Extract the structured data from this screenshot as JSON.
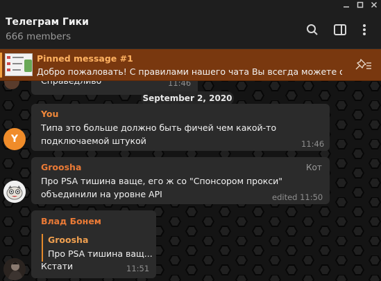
{
  "window": {
    "minimize_icon": "minimize-icon",
    "maximize_icon": "maximize-icon",
    "close_icon": "close-icon"
  },
  "header": {
    "title": "Телеграм Гики",
    "members": "666 members",
    "icons": [
      "search-icon",
      "sidebar-toggle-icon",
      "more-vertical-icon"
    ]
  },
  "pinned": {
    "title": "Pinned message #1",
    "text": "Добро пожаловать! С правилами нашего чата Вы всегда можете оз...",
    "action_icon": "unpin-icon"
  },
  "chat": {
    "date_separator": "September 2, 2020",
    "messages": [
      {
        "text": "Справедливо",
        "time": "11:46"
      },
      {
        "sender": "You",
        "avatar_letter": "Y",
        "text_lines": [
          "Типа это больше должно быть фичей чем какой-то",
          "подключаемой штукой"
        ],
        "time": "11:46"
      },
      {
        "sender": "Groosha",
        "badge": "Кот",
        "text_lines": [
          "Про PSA тишина ваще, его ж со \"Спонсором прокси\"",
          "объединили на уровне API"
        ],
        "time": "edited 11:50"
      },
      {
        "sender": "Влад Бонем",
        "reply_sender": "Groosha",
        "reply_text": "Про PSA тишина ващ...",
        "text": "Кстати",
        "time": "11:51"
      }
    ]
  },
  "colors": {
    "header_bg": "#1e1e1e",
    "pinned_bg": "#79380f",
    "pinned_title": "#ffb261",
    "sender_you": "#f0883a",
    "sender_groosha": "#ea7a36",
    "sender_vlad": "#ea7a36",
    "bubble_bg": "#2b2b2b"
  }
}
